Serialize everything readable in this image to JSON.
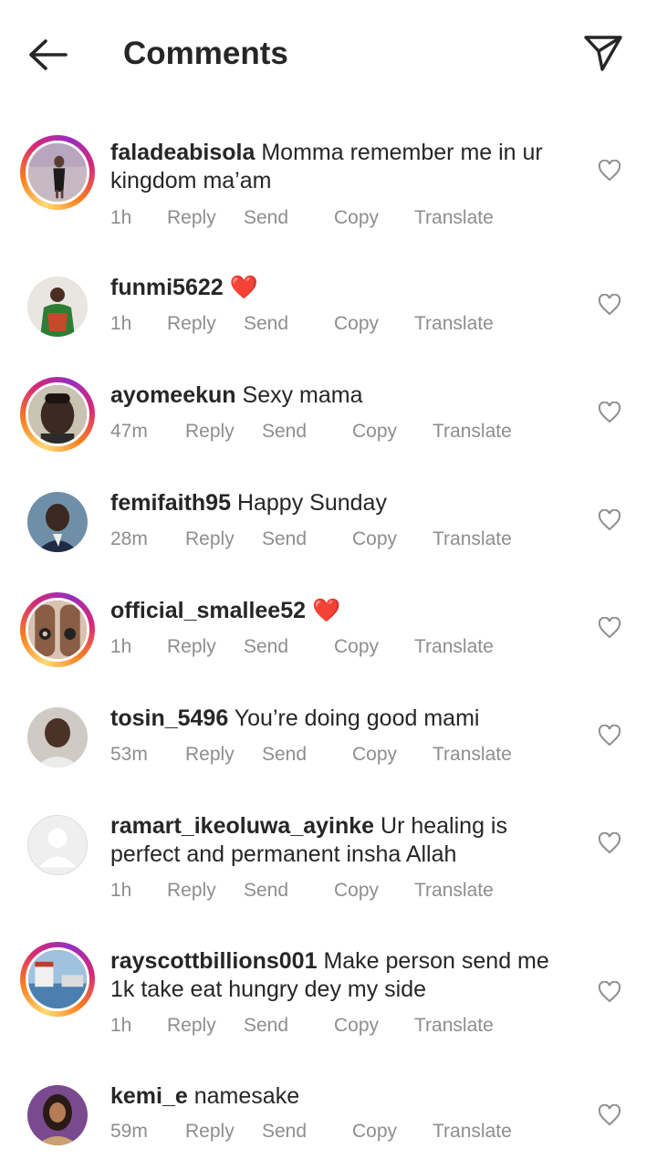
{
  "header": {
    "title": "Comments",
    "back_icon": "arrow-left-icon",
    "share_icon": "paper-plane-icon"
  },
  "actions": {
    "reply": "Reply",
    "send": "Send",
    "copy": "Copy",
    "translate": "Translate"
  },
  "comments": [
    {
      "username": "faladeabisola",
      "text": "Momma remember me in ur kingdom ma’am",
      "time": "1h",
      "story_ring": true
    },
    {
      "username": "funmi5622",
      "text": "❤️",
      "time": "1h",
      "story_ring": false
    },
    {
      "username": "ayomeekun",
      "text": "Sexy mama",
      "time": "47m",
      "story_ring": true
    },
    {
      "username": "femifaith95",
      "text": "Happy Sunday",
      "time": "28m",
      "story_ring": false
    },
    {
      "username": "official_smallee52",
      "text": "❤️",
      "time": "1h",
      "story_ring": true
    },
    {
      "username": "tosin_5496",
      "text": "You’re doing good mami",
      "time": "53m",
      "story_ring": false
    },
    {
      "username": "ramart_ikeoluwa_ayinke",
      "text": "Ur healing is perfect and permanent insha Allah",
      "time": "1h",
      "story_ring": false
    },
    {
      "username": "rayscottbillions001",
      "text": "Make person send me 1k take eat hungry dey my side",
      "time": "1h",
      "story_ring": true
    },
    {
      "username": "kemi_e",
      "text": "namesake",
      "time": "59m",
      "story_ring": false
    }
  ],
  "colors": {
    "text": "#262626",
    "meta": "#8e8e8e",
    "heart": "#ed2a3b"
  }
}
